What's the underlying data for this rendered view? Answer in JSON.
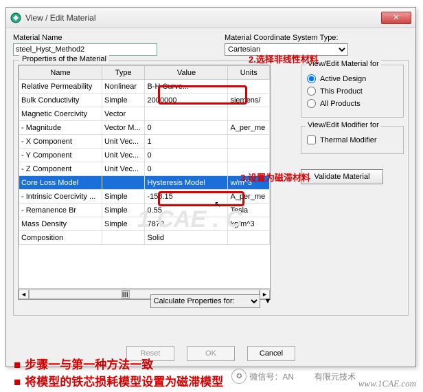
{
  "window": {
    "title": "View / Edit Material"
  },
  "materialName": {
    "label": "Material Name",
    "value": "steel_Hyst_Method2"
  },
  "coordType": {
    "label": "Material Coordinate System Type:",
    "value": "Cartesian"
  },
  "propsLegend": "Properties of the Material",
  "columns": {
    "name": "Name",
    "type": "Type",
    "value": "Value",
    "units": "Units"
  },
  "rows": [
    {
      "name": "Relative Permeability",
      "type": "Nonlinear",
      "value": "B-H Curve...",
      "units": ""
    },
    {
      "name": "Bulk Conductivity",
      "type": "Simple",
      "value": "2000000",
      "units": "siemens/"
    },
    {
      "name": "Magnetic Coercivity",
      "type": "Vector",
      "value": "",
      "units": ""
    },
    {
      "name": "- Magnitude",
      "type": "Vector M...",
      "value": "0",
      "units": "A_per_me"
    },
    {
      "name": "- X Component",
      "type": "Unit Vec...",
      "value": "1",
      "units": ""
    },
    {
      "name": "- Y Component",
      "type": "Unit Vec...",
      "value": "0",
      "units": ""
    },
    {
      "name": "- Z Component",
      "type": "Unit Vec...",
      "value": "0",
      "units": ""
    },
    {
      "name": "Core Loss Model",
      "type": "",
      "value": "Hysteresis Model",
      "units": "w/m^3",
      "selected": true
    },
    {
      "name": "- Intrinsic Coercivity ...",
      "type": "Simple",
      "value": "-158.15",
      "units": "A_per_me"
    },
    {
      "name": "- Remanence Br",
      "type": "Simple",
      "value": "0.55",
      "units": "Tesla"
    },
    {
      "name": "Mass Density",
      "type": "Simple",
      "value": "7872",
      "units": "kg/m^3"
    },
    {
      "name": "Composition",
      "type": "",
      "value": "Solid",
      "units": ""
    }
  ],
  "scrollLabel": "III",
  "viewEditFor": {
    "legend": "View/Edit Material for",
    "opts": [
      {
        "label": "Active Design",
        "checked": true
      },
      {
        "label": "This Product",
        "checked": false
      },
      {
        "label": "All Products",
        "checked": false
      }
    ]
  },
  "modifierFor": {
    "legend": "View/Edit Modifier for",
    "thermal": "Thermal Modifier"
  },
  "validateBtn": "Validate Material",
  "calcFor": "Calculate Properties for:",
  "footBtns": {
    "reset": "Reset",
    "ok": "OK",
    "cancel": "Cancel"
  },
  "annotations": {
    "a1": "2.选择非线性材料",
    "a2": "3.设置为磁滞材料",
    "b1": "步骤一与第一种方法一致",
    "b2": "将模型的铁芯损耗模型设置为磁滞模型"
  },
  "wechat": "微信号：AN",
  "rightText": "有限元技术",
  "url": "www.1CAE.com",
  "watermark": "1 CAE . C"
}
